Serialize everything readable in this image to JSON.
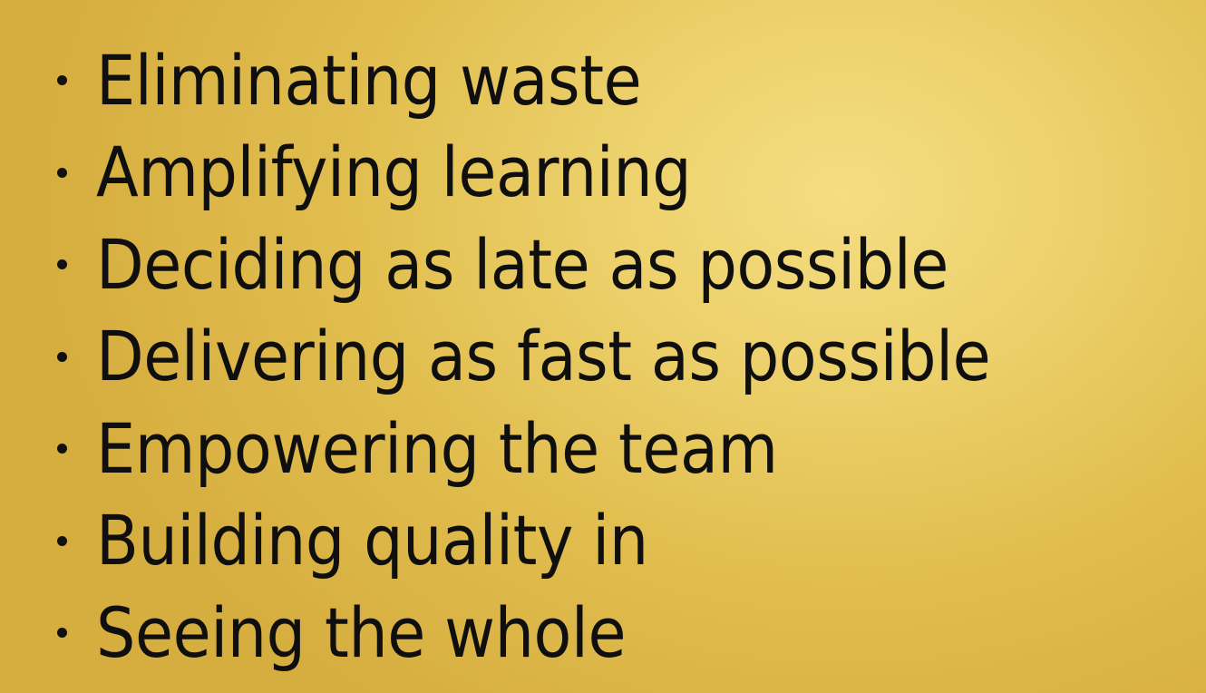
{
  "slide": {
    "bullets": [
      "Eliminating waste",
      "Amplifying learning",
      "Deciding as late as possible",
      "Delivering as fast as possible",
      "Empowering the team",
      "Building quality in",
      "Seeing the whole"
    ]
  },
  "colors": {
    "background_light": "#f4dd82",
    "background_dark": "#d6ad3f",
    "text": "#0f0f0f"
  }
}
